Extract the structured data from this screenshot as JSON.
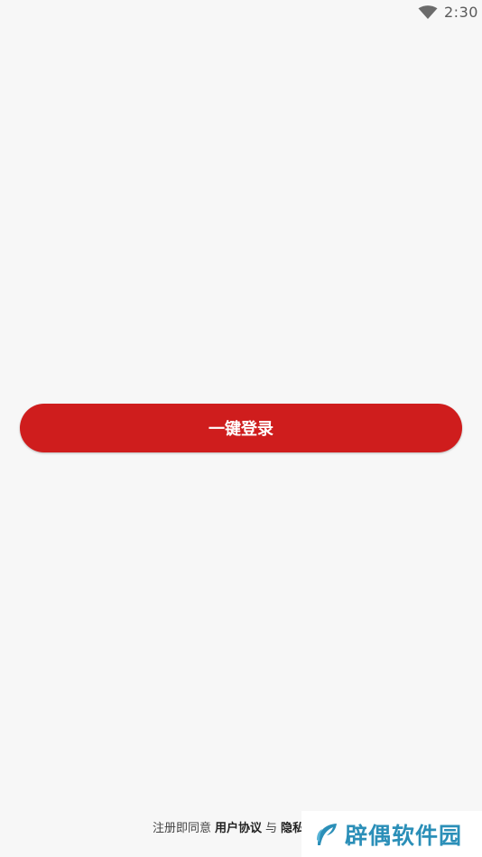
{
  "status_bar": {
    "time": "2:30",
    "wifi_icon": "wifi-icon"
  },
  "login": {
    "button_label": "一键登录",
    "color": "#cf1d1d"
  },
  "agreement": {
    "prefix": "注册即同意",
    "user_agreement": "用户协议",
    "conjunction": "与",
    "privacy_policy_partial": "隐私"
  },
  "watermark": {
    "text": "辟偶软件园",
    "color": "#2b8fb8"
  }
}
